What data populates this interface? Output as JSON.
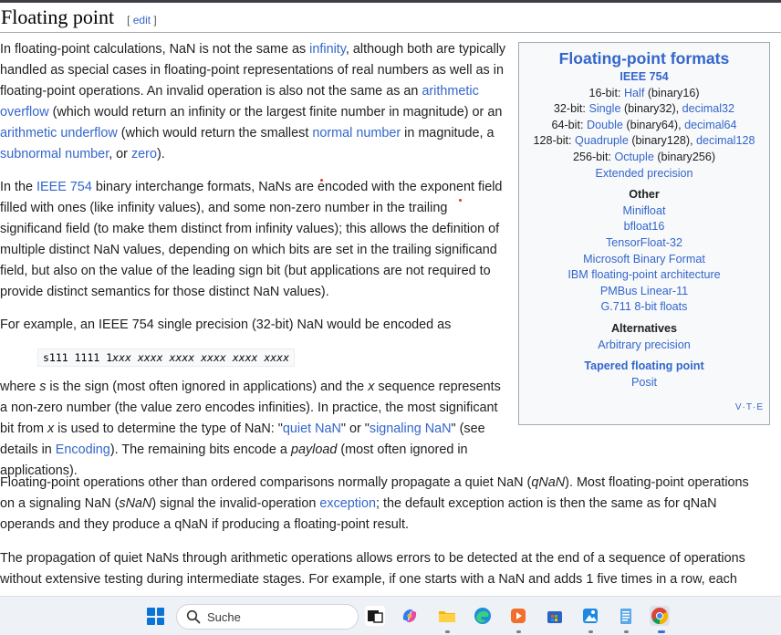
{
  "heading": {
    "title": "Floating point",
    "edit_open": "[ ",
    "edit_label": "edit",
    "edit_close": " ]"
  },
  "paragraphs": {
    "p1": {
      "t0": "In floating-point calculations, NaN is not the same as ",
      "l0": "infinity",
      "t1": ", although both are typically handled as special cases in floating-point representations of real numbers as well as in floating-point operations. An invalid operation is also not the same as an ",
      "l1": "arithmetic overflow",
      "t2": " (which would return an infinity or the largest finite number in magnitude) or an ",
      "l2": "arithmetic underflow",
      "t3": " (which would return the smallest ",
      "l3": "normal number",
      "t4": " in magnitude, a ",
      "l4": "subnormal number",
      "t5": ", or ",
      "l5": "zero",
      "t6": ")."
    },
    "p2": {
      "t0": "In the ",
      "l0": "IEEE 754",
      "t1": " binary interchange formats, NaNs are encoded with the exponent field filled with ones (like infinity values), and some non-zero number in the trailing significand field (to make them distinct from infinity values); this allows the definition of multiple distinct NaN values, depending on which bits are set in the trailing significand field, but also on the value of the leading sign bit (but applications are not required to provide distinct semantics for those distinct NaN values)."
    },
    "p3": {
      "t0": "For example, an IEEE 754 single precision (32-bit) NaN would be encoded as"
    },
    "code": {
      "plain": "s111 1111 1",
      "italic": "xxx xxxx xxxx xxxx xxxx xxxx"
    },
    "p4": {
      "t0": "where ",
      "e0": "s",
      "t1": " is the sign (most often ignored in applications) and the ",
      "e1": "x",
      "t2": " sequence represents a non-zero number (the value zero encodes infinities). In practice, the most significant bit from ",
      "e2": "x",
      "t3": " is used to determine the type of NaN: \"",
      "l0": "quiet NaN",
      "t4": "\" or \"",
      "l1": "signaling NaN",
      "t5": "\" (see details in ",
      "l2": "Encoding",
      "t6": "). The remaining bits encode a ",
      "e3": "payload",
      "t7": " (most often ignored in applications)."
    },
    "p5": {
      "t0": "Floating-point operations other than ordered comparisons normally propagate a quiet NaN (",
      "e0": "qNaN",
      "t1": "). Most floating-point operations on a signaling NaN (",
      "e1": "sNaN",
      "t2": ") signal the invalid-operation ",
      "l0": "exception",
      "t3": "; the default exception action is then the same as for qNaN operands and they produce a qNaN if producing a floating-point result."
    },
    "p6": {
      "t0": "The propagation of quiet NaNs through arithmetic operations allows errors to be detected at the end of a sequence of operations without extensive testing during intermediate stages. For example, if one starts with a NaN and adds 1 five times in a row, each"
    }
  },
  "navbox": {
    "title": "Floating-point formats",
    "subtitle": "IEEE 754",
    "rows": [
      {
        "prefix": "16-bit: ",
        "link1": "Half",
        "mid": " (binary16)",
        "link2": "",
        "end": ""
      },
      {
        "prefix": "32-bit: ",
        "link1": "Single",
        "mid": " (binary32), ",
        "link2": "decimal32",
        "end": ""
      },
      {
        "prefix": "64-bit: ",
        "link1": "Double",
        "mid": " (binary64), ",
        "link2": "decimal64",
        "end": ""
      },
      {
        "prefix": "128-bit: ",
        "link1": "Quadruple",
        "mid": " (binary128), ",
        "link2": "decimal128",
        "end": ""
      },
      {
        "prefix": "256-bit: ",
        "link1": "Octuple",
        "mid": " (binary256)",
        "link2": "",
        "end": ""
      }
    ],
    "extended": "Extended precision",
    "other_heading": "Other",
    "other_links": [
      "Minifloat",
      "bfloat16",
      "TensorFloat-32",
      "Microsoft Binary Format",
      "IBM floating-point architecture",
      "PMBus Linear-11",
      "G.711 8-bit floats"
    ],
    "alternatives_heading": "Alternatives",
    "alternatives_link": "Arbitrary precision",
    "tapered_heading": "Tapered floating point",
    "tapered_link": "Posit",
    "vte": "V·T·E"
  },
  "taskbar": {
    "search_text": "Suche",
    "apps": [
      "task-view",
      "copilot",
      "file-explorer",
      "edge",
      "media-player",
      "store",
      "photos",
      "notepad",
      "chrome"
    ]
  },
  "colors": {
    "link": "#3366cc",
    "text": "#202122",
    "navbox_bg": "#f8f9fa",
    "navbox_border": "#a2a9b1",
    "taskbar_bg": "#eef1f6"
  }
}
